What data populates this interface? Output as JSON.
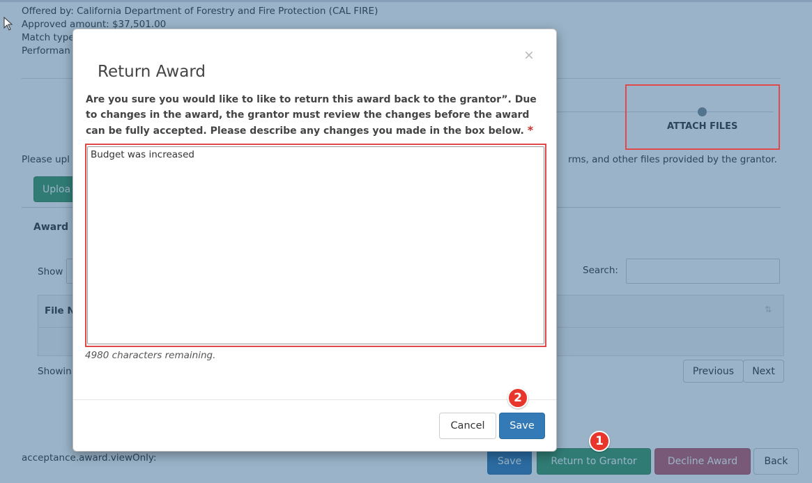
{
  "background": {
    "offered_by": "Offered by: California Department of Forestry and Fire Protection (CAL FIRE)",
    "approved_amount": "Approved amount: $37,501.00",
    "match_type": "Match type",
    "performance": "Performan",
    "step_label": "ATTACH FILES",
    "upload_instruction_left": "Please upl",
    "upload_instruction_right": "rms, and other files provided by the grantor.",
    "upload_button": "Uploa",
    "award_section": "Award",
    "show_label": "Show",
    "search_label": "Search:",
    "search_value": "",
    "file_header": "File N",
    "sort_icon": "sort-icon",
    "showing_text": "Showin",
    "previous_button": "Previous",
    "next_button": "Next",
    "view_only_label": "acceptance.award.viewOnly:",
    "bottom_buttons": {
      "save": "Save",
      "return_to_grantor": "Return to Grantor",
      "decline_award": "Decline Award",
      "back": "Back"
    }
  },
  "modal": {
    "title": "Return Award",
    "close_icon": "close-icon",
    "message": "Are you sure you would like to like to return this award back to the grantor”. Due to changes in the award, the grantor must review the changes before the award can be fully accepted. Please describe any changes you made in the box below.",
    "required_marker": "*",
    "textarea_value": "Budget was increased",
    "chars_remaining": "4980 characters remaining.",
    "cancel_button": "Cancel",
    "save_button": "Save"
  },
  "annotations": {
    "step_one": "1",
    "step_two": "2",
    "highlight_color": "#e0484a"
  },
  "colors": {
    "overlay": "#235a87",
    "primary": "#337ab7",
    "success": "#3c9a66",
    "danger": "#c15a6a"
  }
}
